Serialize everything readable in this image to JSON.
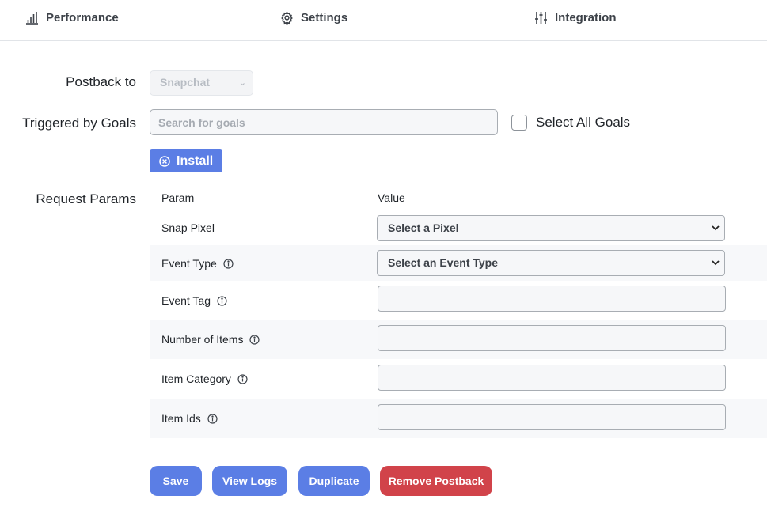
{
  "tabs": [
    {
      "label": "Performance",
      "icon": "bar-chart-icon"
    },
    {
      "label": "Settings",
      "icon": "gear-icon"
    },
    {
      "label": "Integration",
      "icon": "sliders-icon"
    }
  ],
  "form": {
    "postback_label": "Postback to",
    "postback_value": "Snapchat",
    "goals_label": "Triggered by Goals",
    "goals_placeholder": "Search for goals",
    "select_all_label": "Select All Goals",
    "install_label": "Install",
    "params_label": "Request Params"
  },
  "params": {
    "header_param": "Param",
    "header_value": "Value",
    "rows": [
      {
        "name": "Snap Pixel",
        "type": "select",
        "value": "Select a Pixel",
        "info": false
      },
      {
        "name": "Event Type",
        "type": "select",
        "value": "Select an Event Type",
        "info": true
      },
      {
        "name": "Event Tag",
        "type": "input",
        "value": "",
        "info": true
      },
      {
        "name": "Number of Items",
        "type": "input",
        "value": "",
        "info": true
      },
      {
        "name": "Item Category",
        "type": "input",
        "value": "",
        "info": true
      },
      {
        "name": "Item Ids",
        "type": "input",
        "value": "",
        "info": true
      }
    ]
  },
  "actions": {
    "save": "Save",
    "view_logs": "View Logs",
    "duplicate": "Duplicate",
    "remove": "Remove Postback"
  },
  "colors": {
    "primary": "#5b7ee5",
    "danger": "#d1434a"
  }
}
